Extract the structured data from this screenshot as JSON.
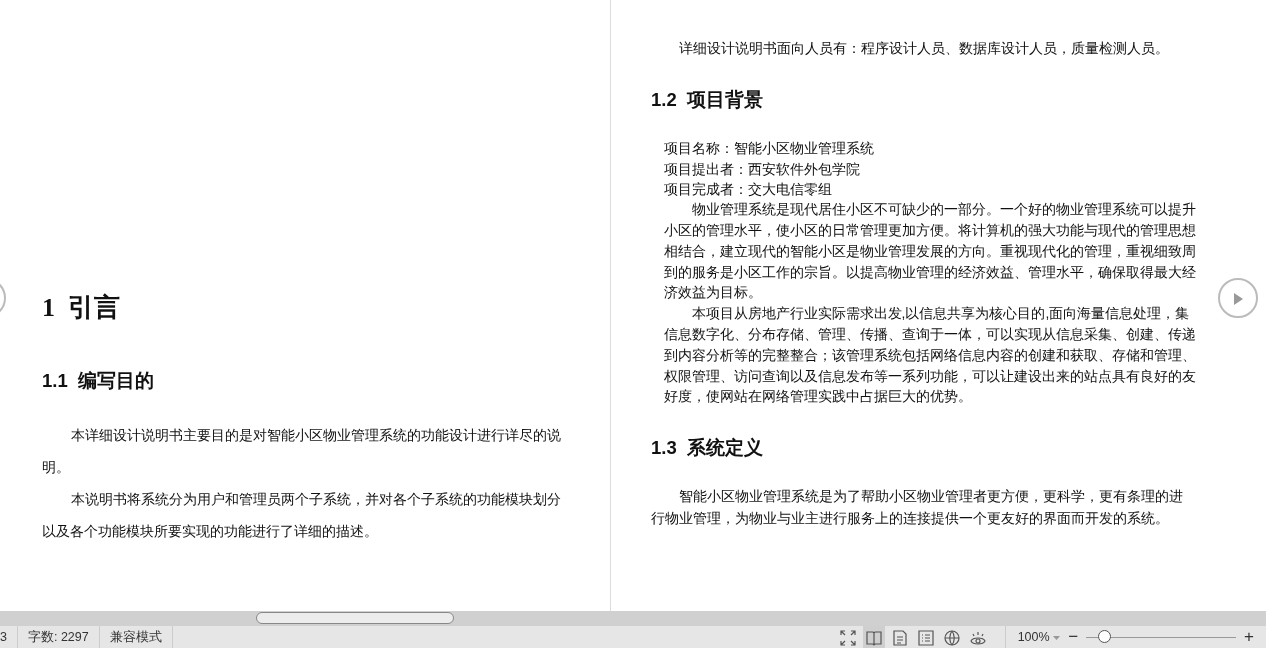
{
  "pages": [
    {
      "blocks": [
        {
          "kind": "h1",
          "number": "1",
          "text": "引言"
        },
        {
          "kind": "h2",
          "number": "1.1",
          "text": "编写目的"
        },
        {
          "kind": "para",
          "text": "本详细设计说明书主要目的是对智能小区物业管理系统的功能设计进行详尽的说明。"
        },
        {
          "kind": "para",
          "text": "本说明书将系统分为用户和管理员两个子系统，并对各个子系统的功能模块划分以及各个功能模块所要实现的功能进行了详细的描述。"
        }
      ]
    },
    {
      "blocks": [
        {
          "kind": "para",
          "text": "详细设计说明书面向人员有：程序设计人员、数据库设计人员，质量检测人员。"
        },
        {
          "kind": "h2",
          "number": "1.2",
          "text": "项目背景"
        },
        {
          "kind": "line",
          "text": "项目名称：智能小区物业管理系统"
        },
        {
          "kind": "line",
          "text": "项目提出者：西安软件外包学院"
        },
        {
          "kind": "line",
          "text": "项目完成者：交大电信零组"
        },
        {
          "kind": "inset_para",
          "text": "物业管理系统是现代居住小区不可缺少的一部分。一个好的物业管理系统可以提升小区的管理水平，使小区的日常管理更加方便。将计算机的强大功能与现代的管理思想相结合，建立现代的智能小区是物业管理发展的方向。重视现代化的管理，重视细致周到的服务是小区工作的宗旨。以提高物业管理的经济效益、管理水平，确保取得最大经济效益为目标。"
        },
        {
          "kind": "inset_para",
          "text": "本项目从房地产行业实际需求出发,以信息共享为核心目的,面向海量信息处理，集信息数字化、分布存储、管理、传播、查询于一体，可以实现从信息采集、创建、传递到内容分析等的完整整合；该管理系统包括网络信息内容的创建和获取、存储和管理、权限管理、访问查询以及信息发布等一系列功能，可以让建设出来的站点具有良好的友好度，使网站在网络管理实践中占据巨大的优势。"
        },
        {
          "kind": "h2",
          "number": "1.3",
          "text": "系统定义"
        },
        {
          "kind": "para",
          "text": "智能小区物业管理系统是为了帮助小区物业管理者更方便，更科学，更有条理的进行物业管理，为物业与业主进行服务上的连接提供一个更友好的界面而开发的系统。"
        }
      ]
    }
  ],
  "status_bar": {
    "page": "3",
    "word_count": "字数: 2297",
    "mode": "兼容模式",
    "view_modes": [
      {
        "kind": "fullscreen",
        "selected": false
      },
      {
        "kind": "reading",
        "selected": true
      },
      {
        "kind": "page",
        "selected": false
      },
      {
        "kind": "outline",
        "selected": false
      },
      {
        "kind": "web",
        "selected": false
      },
      {
        "kind": "eye",
        "selected": false
      }
    ],
    "zoom": "100%",
    "zoom_level": {
      "level": 0.12
    },
    "zoom_out": "−",
    "zoom_in": "+"
  }
}
